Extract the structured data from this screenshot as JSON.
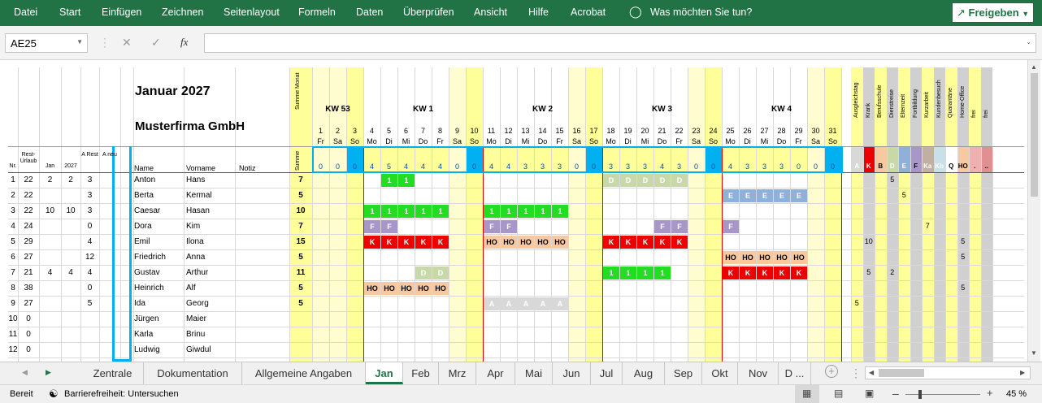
{
  "ribbon": {
    "menu": [
      "Datei",
      "Start",
      "Einfügen",
      "Zeichnen",
      "Seitenlayout",
      "Formeln",
      "Daten",
      "Überprüfen",
      "Ansicht",
      "Hilfe",
      "Acrobat"
    ],
    "tellme": "Was möchten Sie tun?",
    "share": "Freigeben"
  },
  "formula_bar": {
    "namebox": "AE25",
    "fx": "fx",
    "content": ""
  },
  "header": {
    "title": "Januar 2027",
    "company": "Musterfirma GmbH",
    "summe_monat": "Summe Monat",
    "summe": "Summe"
  },
  "cols": {
    "nr": "Nr.",
    "rest_urlaub": "Rest-Urlaub",
    "jan": "Jan",
    "year": "2027",
    "a_rest": "A Rest",
    "a_neu": "A neu",
    "name": "Name",
    "vorname": "Vorname",
    "notiz": "Notiz"
  },
  "weeks": [
    "KW 53",
    "KW 1",
    "KW 2",
    "KW 3",
    "KW 4"
  ],
  "days": [
    "1",
    "2",
    "3",
    "4",
    "5",
    "6",
    "7",
    "8",
    "9",
    "10",
    "11",
    "12",
    "13",
    "14",
    "15",
    "16",
    "17",
    "18",
    "19",
    "20",
    "21",
    "22",
    "23",
    "24",
    "25",
    "26",
    "27",
    "28",
    "29",
    "30",
    "31"
  ],
  "weekdays": [
    "Fr",
    "Sa",
    "So",
    "Mo",
    "Di",
    "Mi",
    "Do",
    "Fr",
    "Sa",
    "So",
    "Mo",
    "Di",
    "Mi",
    "Do",
    "Fr",
    "Sa",
    "So",
    "Mo",
    "Di",
    "Mi",
    "Do",
    "Fr",
    "Sa",
    "So",
    "Mo",
    "Di",
    "Mi",
    "Do",
    "Fr",
    "Sa",
    "So"
  ],
  "day_counts": [
    "0",
    "0",
    "0",
    "4",
    "5",
    "4",
    "4",
    "4",
    "0",
    "0",
    "4",
    "4",
    "3",
    "3",
    "3",
    "0",
    "0",
    "3",
    "3",
    "3",
    "4",
    "3",
    "0",
    "0",
    "4",
    "3",
    "3",
    "3",
    "0",
    "0",
    "0"
  ],
  "categories": [
    "Ausgleichstag",
    "Krank",
    "Berufsschule",
    "Dienstreise",
    "Elternzeit",
    "Fortbildung",
    "Kurzarbeit",
    "Kundenbesuch",
    "Quarantäne",
    "Home-Office",
    "frei",
    "frei"
  ],
  "category_codes": [
    "A",
    "K",
    "B",
    "D",
    "E",
    "F",
    "Ka",
    "Kb",
    "Q",
    "HO",
    ".",
    ".."
  ],
  "employees": [
    {
      "nr": "1",
      "rest": "22",
      "jan": "2",
      "y2027": "2",
      "arest": "3",
      "name": "Anton",
      "vorname": "Hans",
      "summe": "7"
    },
    {
      "nr": "2",
      "rest": "22",
      "jan": "",
      "y2027": "",
      "arest": "3",
      "name": "Berta",
      "vorname": "Kermal",
      "summe": "5"
    },
    {
      "nr": "3",
      "rest": "22",
      "jan": "10",
      "y2027": "10",
      "arest": "3",
      "name": "Caesar",
      "vorname": "Hasan",
      "summe": "10"
    },
    {
      "nr": "4",
      "rest": "24",
      "jan": "",
      "y2027": "",
      "arest": "0",
      "name": "Dora",
      "vorname": "Kim",
      "summe": "7"
    },
    {
      "nr": "5",
      "rest": "29",
      "jan": "",
      "y2027": "",
      "arest": "4",
      "name": "Emil",
      "vorname": "Ilona",
      "summe": "15"
    },
    {
      "nr": "6",
      "rest": "27",
      "jan": "",
      "y2027": "",
      "arest": "12",
      "name": "Friedrich",
      "vorname": "Anna",
      "summe": "5"
    },
    {
      "nr": "7",
      "rest": "21",
      "jan": "4",
      "y2027": "4",
      "arest": "4",
      "name": "Gustav",
      "vorname": "Arthur",
      "summe": "11"
    },
    {
      "nr": "8",
      "rest": "38",
      "jan": "",
      "y2027": "",
      "arest": "0",
      "name": "Heinrich",
      "vorname": "Alf",
      "summe": "5"
    },
    {
      "nr": "9",
      "rest": "27",
      "jan": "",
      "y2027": "",
      "arest": "5",
      "name": "Ida",
      "vorname": "Georg",
      "summe": "5"
    },
    {
      "nr": "10",
      "rest": "0",
      "jan": "",
      "y2027": "",
      "arest": "",
      "name": "Jürgen",
      "vorname": "Maier",
      "summe": ""
    },
    {
      "nr": "11",
      "rest": "0",
      "jan": "",
      "y2027": "",
      "arest": "",
      "name": "Karla",
      "vorname": "Brinu",
      "summe": ""
    },
    {
      "nr": "12",
      "rest": "0",
      "jan": "",
      "y2027": "",
      "arest": "",
      "name": "Ludwig",
      "vorname": "Giwdul",
      "summe": ""
    }
  ],
  "entries": [
    {
      "row": 0,
      "days": [
        5,
        6
      ],
      "code": "1",
      "color": "#22dd22"
    },
    {
      "row": 0,
      "days": [
        18,
        19,
        20,
        21,
        22
      ],
      "code": "D",
      "color": "#c8d8a8"
    },
    {
      "row": 1,
      "days": [
        25,
        26,
        27,
        28,
        29
      ],
      "code": "E",
      "color": "#8fb0d8"
    },
    {
      "row": 2,
      "days": [
        4,
        5,
        6,
        7,
        8
      ],
      "code": "1",
      "color": "#22dd22"
    },
    {
      "row": 2,
      "days": [
        11,
        12,
        13,
        14,
        15
      ],
      "code": "1",
      "color": "#22dd22"
    },
    {
      "row": 3,
      "days": [
        4,
        5
      ],
      "code": "F",
      "color": "#a896c8"
    },
    {
      "row": 3,
      "days": [
        11,
        12
      ],
      "code": "F",
      "color": "#a896c8"
    },
    {
      "row": 3,
      "days": [
        21,
        22
      ],
      "code": "F",
      "color": "#a896c8"
    },
    {
      "row": 3,
      "days": [
        25
      ],
      "code": "F",
      "color": "#a896c8"
    },
    {
      "row": 4,
      "days": [
        4,
        5,
        6,
        7,
        8
      ],
      "code": "K",
      "color": "#ee0000"
    },
    {
      "row": 4,
      "days": [
        11,
        12,
        13,
        14,
        15
      ],
      "code": "HO",
      "color": "#f8c8a0"
    },
    {
      "row": 4,
      "days": [
        18,
        19,
        20,
        21,
        22
      ],
      "code": "K",
      "color": "#ee0000"
    },
    {
      "row": 5,
      "days": [
        25,
        26,
        27,
        28,
        29
      ],
      "code": "HO",
      "color": "#f8c8a0"
    },
    {
      "row": 6,
      "days": [
        7,
        8
      ],
      "code": "D",
      "color": "#c8d8a8"
    },
    {
      "row": 6,
      "days": [
        18,
        19,
        20,
        21
      ],
      "code": "1",
      "color": "#22dd22"
    },
    {
      "row": 6,
      "days": [
        25,
        26,
        27,
        28,
        29
      ],
      "code": "K",
      "color": "#ee0000"
    },
    {
      "row": 7,
      "days": [
        4,
        5,
        6,
        7,
        8
      ],
      "code": "HO",
      "color": "#f8c8a0"
    },
    {
      "row": 8,
      "days": [
        11,
        12,
        13,
        14,
        15
      ],
      "code": "A",
      "color": "#d8d8d8"
    }
  ],
  "cat_values": [
    {
      "row": 0,
      "cat": 3,
      "value": "5"
    },
    {
      "row": 1,
      "cat": 4,
      "value": "5"
    },
    {
      "row": 3,
      "cat": 6,
      "value": "7"
    },
    {
      "row": 4,
      "cat": 1,
      "value": "10"
    },
    {
      "row": 4,
      "cat": 9,
      "value": "5"
    },
    {
      "row": 5,
      "cat": 9,
      "value": "5"
    },
    {
      "row": 6,
      "cat": 1,
      "value": "5"
    },
    {
      "row": 6,
      "cat": 3,
      "value": "2"
    },
    {
      "row": 7,
      "cat": 9,
      "value": "5"
    },
    {
      "row": 8,
      "cat": 0,
      "value": "5"
    }
  ],
  "tabs": [
    "Zentrale",
    "Dokumentation",
    "Allgemeine Angaben",
    "Jan",
    "Feb",
    "Mrz",
    "Apr",
    "Mai",
    "Jun",
    "Jul",
    "Aug",
    "Sep",
    "Okt",
    "Nov",
    "D ..."
  ],
  "active_tab": "Jan",
  "status": {
    "ready": "Bereit",
    "accessibility": "Barrierefreiheit: Untersuchen",
    "zoom": "45 %"
  }
}
